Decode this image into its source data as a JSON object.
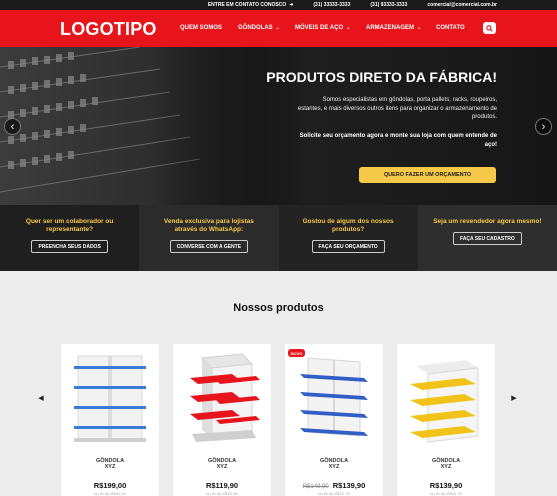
{
  "topbar": {
    "contact_cta": "ENTRE EM CONTATO CONOSCO",
    "phone1": "(31) 33333-3333",
    "phone2": "(31) 93333-3333",
    "email": "comercial@comercial.com.br"
  },
  "header": {
    "logo": "LOGOTIPO",
    "nav": [
      {
        "label": "QUEM SOMOS",
        "dropdown": false
      },
      {
        "label": "GÔNDOLAS",
        "dropdown": true
      },
      {
        "label": "MÓVEIS DE AÇO",
        "dropdown": true
      },
      {
        "label": "ARMAZENAGEM",
        "dropdown": true
      },
      {
        "label": "CONTATO",
        "dropdown": false
      }
    ]
  },
  "hero": {
    "title": "PRODUTOS DIRETO DA FÁBRICA!",
    "text": "Somos especialistas em gôndolas, porta pallets, racks, roupeiros, estantes, e mais diversos outros itens para organizar o armazenamento de produtos.",
    "text_bold": "Solicite seu orçamento agora e monte sua loja com quem entende de aço!",
    "button": "QUERO FAZER UM ORÇAMENTO"
  },
  "strip": [
    {
      "text": "Quer ser um colaborador ou representante?",
      "button": "PREENCHA SEUS DADOS"
    },
    {
      "text": "Venda exclusiva para lojistas através do WhatsApp:",
      "button": "CONVERSE COM A GENTE"
    },
    {
      "text": "Gostou de algum dos nossos produtos?",
      "button": "FAÇA SEU ORÇAMENTO"
    },
    {
      "text": "Seja um revendedor agora mesmo!",
      "button": "FAÇA SEU CADASTRO"
    }
  ],
  "products": {
    "title": "Nossos produtos",
    "items": [
      {
        "name": "GÔNDOLA",
        "sub": "XYZ",
        "old_price": "",
        "price": "R$199,00",
        "installments": "ou 6x de R$40,00",
        "badge": "",
        "accent": "#3a7bd5"
      },
      {
        "name": "GÔNDOLA",
        "sub": "XYZ",
        "old_price": "",
        "price": "R$119,90",
        "installments": "ou 6x de R$22,50",
        "badge": "",
        "accent": "#e8141b"
      },
      {
        "name": "GÔNDOLA",
        "sub": "XYZ",
        "old_price": "R$149,90",
        "price": "R$139,90",
        "installments": "ou 6x de R$22,70",
        "badge": "NOVO",
        "accent": "#2f5fc4"
      },
      {
        "name": "GÔNDOLA",
        "sub": "XYZ",
        "old_price": "",
        "price": "R$139,90",
        "installments": "ou 6x de R$22,70",
        "badge": "",
        "accent": "#f1c31a"
      }
    ]
  },
  "colors": {
    "brand_red": "#e8141b",
    "cta_yellow": "#f7c948",
    "dark": "#1f1f1f"
  }
}
